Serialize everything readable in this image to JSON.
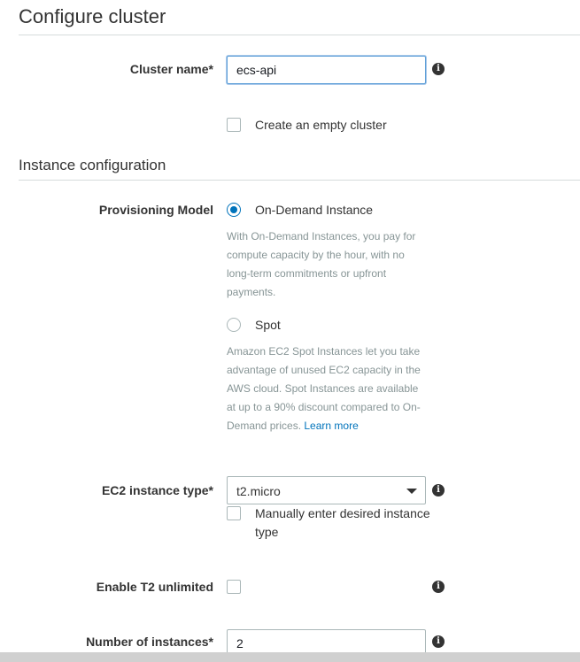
{
  "configure": {
    "title": "Configure cluster",
    "cluster_name_label": "Cluster name*",
    "cluster_name_value": "ecs-api",
    "empty_cluster_label": "Create an empty cluster"
  },
  "instance": {
    "section_title": "Instance configuration",
    "provisioning_label": "Provisioning Model",
    "on_demand_label": "On-Demand Instance",
    "on_demand_desc": "With On-Demand Instances, you pay for compute capacity by the hour, with no long-term commitments or upfront payments.",
    "spot_label": "Spot",
    "spot_desc": "Amazon EC2 Spot Instances let you take advantage of unused EC2 capacity in the AWS cloud. Spot Instances are available at up to a 90% discount compared to On-Demand prices. ",
    "learn_more": "Learn more",
    "ec2_type_label": "EC2 instance type*",
    "ec2_type_value": "t2.micro",
    "manual_type_label": "Manually enter desired instance type",
    "t2_unlimited_label": "Enable T2 unlimited",
    "num_instances_label": "Number of instances*",
    "num_instances_value": "2"
  },
  "icons": {
    "info": "i"
  }
}
